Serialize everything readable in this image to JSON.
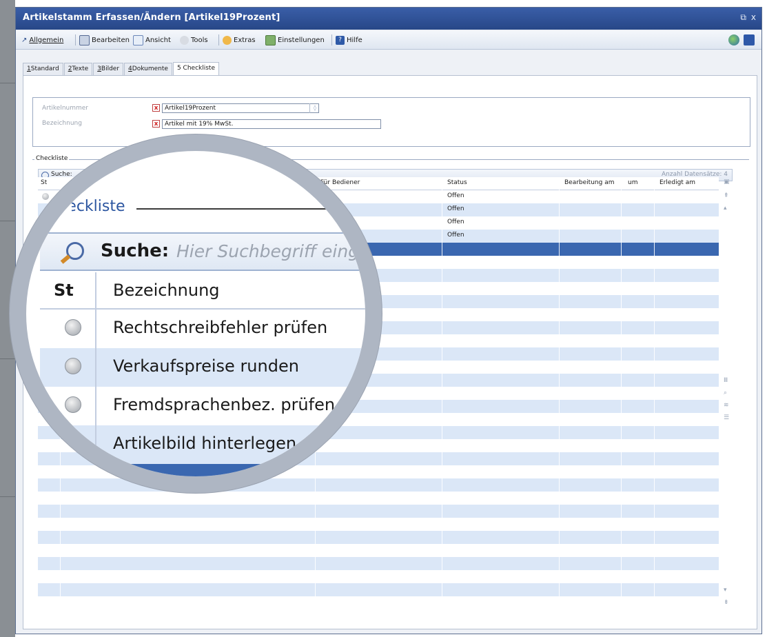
{
  "window": {
    "title": "Artikelstamm Erfassen/Ändern [Artikel19Prozent]",
    "controls": [
      "⧉",
      "x"
    ]
  },
  "menu": [
    {
      "label": "Allgemein",
      "icon": "arrow-icon"
    },
    {
      "label": "Bearbeiten",
      "icon": "edit-icon"
    },
    {
      "label": "Ansicht",
      "icon": "view-icon"
    },
    {
      "label": "Tools",
      "icon": "tools-icon"
    },
    {
      "label": "Extras",
      "icon": "extras-icon"
    },
    {
      "label": "Einstellungen",
      "icon": "settings-icon"
    },
    {
      "label": "Hilfe",
      "icon": "help-icon"
    }
  ],
  "tabs": [
    {
      "num": "1",
      "label": "Standard"
    },
    {
      "num": "2",
      "label": "Texte"
    },
    {
      "num": "3",
      "label": "Bilder"
    },
    {
      "num": "4",
      "label": "Dokumente"
    },
    {
      "num": "5",
      "label": "Checkliste",
      "active": true
    }
  ],
  "form": {
    "artikelnummer_label": "Artikelnummer",
    "artikelnummer_value": "Artikel19Prozent",
    "bezeichnung_label": "Bezeichnung",
    "bezeichnung_value": "Artikel mit 19% MwSt."
  },
  "checkliste": {
    "group_title": "Checkliste",
    "search_label": "Suche:",
    "search_placeholder": "Hier Suchbegriff eing",
    "count_label": "Anzahl Datensätze: 4",
    "columns": {
      "st": "St",
      "bezeichnung": "Bezeichnung",
      "fuer_bediener": "Für Bediener",
      "status": "Status",
      "bearbeitung_am": "Bearbeitung am",
      "um": "um",
      "erledigt_am": "Erledigt am"
    },
    "rows": [
      {
        "bezeichnung": "Rechtschreibfehler prüfen",
        "status": "Offen"
      },
      {
        "bezeichnung": "Verkaufspreise runden",
        "status": "Offen"
      },
      {
        "bezeichnung": "Fremdsprachenbez. prüfen",
        "status": "Offen"
      },
      {
        "bezeichnung": "Artikelbild hinterlegen",
        "status": "Offen"
      }
    ]
  },
  "colors": {
    "titlebar": "#274787",
    "row_alt": "#dbe7f7",
    "row_selected": "#3a67b0"
  }
}
